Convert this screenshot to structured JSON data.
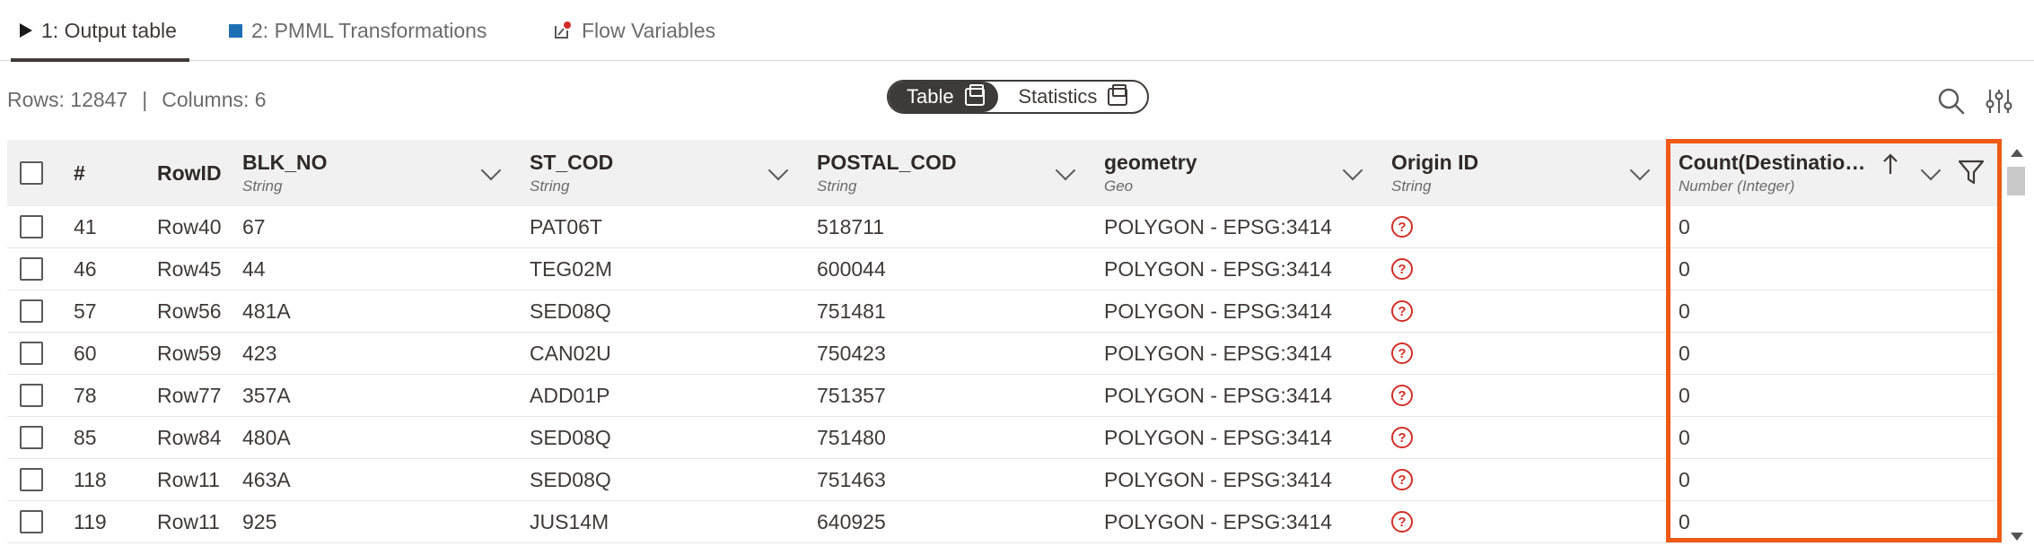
{
  "tabs": [
    {
      "label": "1: Output table",
      "icon": "play-icon",
      "active": true
    },
    {
      "label": "2: PMML Transformations",
      "icon": "blue-square-icon",
      "active": false
    },
    {
      "label": "Flow Variables",
      "icon": "flow-variable-icon",
      "active": false
    }
  ],
  "toolbar": {
    "rows_label": "Rows: 12847",
    "separator": "|",
    "columns_label": "Columns: 6",
    "view_toggle": {
      "table_label": "Table",
      "statistics_label": "Statistics",
      "selected": "Table"
    }
  },
  "columns": [
    {
      "name": "#",
      "type": ""
    },
    {
      "name": "RowID",
      "type": ""
    },
    {
      "name": "BLK_NO",
      "type": "String"
    },
    {
      "name": "ST_COD",
      "type": "String"
    },
    {
      "name": "POSTAL_COD",
      "type": "String"
    },
    {
      "name": "geometry",
      "type": "Geo"
    },
    {
      "name": "Origin ID",
      "type": "String"
    },
    {
      "name": "Count(Destinatio…",
      "type": "Number (Integer)"
    }
  ],
  "rows": [
    {
      "index": "41",
      "rowid": "Row40",
      "blk_no": "67",
      "st_cod": "PAT06T",
      "postal": "518711",
      "geometry": "POLYGON - EPSG:3414",
      "origin": "?",
      "count": "0"
    },
    {
      "index": "46",
      "rowid": "Row45",
      "blk_no": "44",
      "st_cod": "TEG02M",
      "postal": "600044",
      "geometry": "POLYGON - EPSG:3414",
      "origin": "?",
      "count": "0"
    },
    {
      "index": "57",
      "rowid": "Row56",
      "blk_no": "481A",
      "st_cod": "SED08Q",
      "postal": "751481",
      "geometry": "POLYGON - EPSG:3414",
      "origin": "?",
      "count": "0"
    },
    {
      "index": "60",
      "rowid": "Row59",
      "blk_no": "423",
      "st_cod": "CAN02U",
      "postal": "750423",
      "geometry": "POLYGON - EPSG:3414",
      "origin": "?",
      "count": "0"
    },
    {
      "index": "78",
      "rowid": "Row77",
      "blk_no": "357A",
      "st_cod": "ADD01P",
      "postal": "751357",
      "geometry": "POLYGON - EPSG:3414",
      "origin": "?",
      "count": "0"
    },
    {
      "index": "85",
      "rowid": "Row84",
      "blk_no": "480A",
      "st_cod": "SED08Q",
      "postal": "751480",
      "geometry": "POLYGON - EPSG:3414",
      "origin": "?",
      "count": "0"
    },
    {
      "index": "118",
      "rowid": "Row11",
      "blk_no": "463A",
      "st_cod": "SED08Q",
      "postal": "751463",
      "geometry": "POLYGON - EPSG:3414",
      "origin": "?",
      "count": "0"
    },
    {
      "index": "119",
      "rowid": "Row11",
      "blk_no": "925",
      "st_cod": "JUS14M",
      "postal": "640925",
      "geometry": "POLYGON - EPSG:3414",
      "origin": "?",
      "count": "0"
    }
  ],
  "colors": {
    "highlight": "#ef5a16",
    "missing": "#d22f27",
    "dark": "#3e3a39",
    "tab_square": "#1f6fb5"
  }
}
